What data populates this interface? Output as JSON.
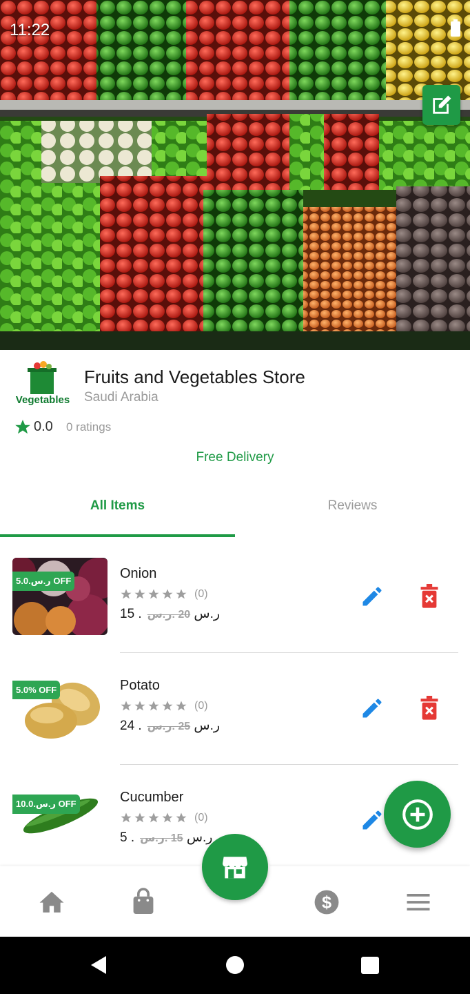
{
  "status_bar": {
    "time": "11:22"
  },
  "store": {
    "logo_text": "Vegetables",
    "name": "Fruits and Vegetables Store",
    "country": "Saudi Arabia",
    "rating": "0.0",
    "rating_count": "0 ratings",
    "delivery": "Free Delivery"
  },
  "tabs": [
    {
      "label": "All Items",
      "active": true
    },
    {
      "label": "Reviews",
      "active": false
    }
  ],
  "items": [
    {
      "name": "Onion",
      "badge": "ر.س.5.0 OFF",
      "stars": 0,
      "review_count": "(0)",
      "price": "15 .ر.س",
      "old_price": "20 .ر.س"
    },
    {
      "name": "Potato",
      "badge": "5.0% OFF",
      "stars": 0,
      "review_count": "(0)",
      "price": "24 .ر.س",
      "old_price": "25 .ر.س"
    },
    {
      "name": "Cucumber",
      "badge": "ر.س.10.0 OFF",
      "stars": 0,
      "review_count": "(0)",
      "price": "5 .ر.س",
      "old_price": "15 .ر.س"
    }
  ],
  "colors": {
    "accent": "#1f9a46",
    "delete": "#e53935",
    "edit": "#1e88e5"
  },
  "icons": {
    "bottom_nav": [
      "home-icon",
      "shopping-bag-icon",
      "store-icon",
      "dollar-icon",
      "menu-icon"
    ],
    "system_nav": [
      "back-icon",
      "home-circle-icon",
      "recents-icon"
    ]
  }
}
